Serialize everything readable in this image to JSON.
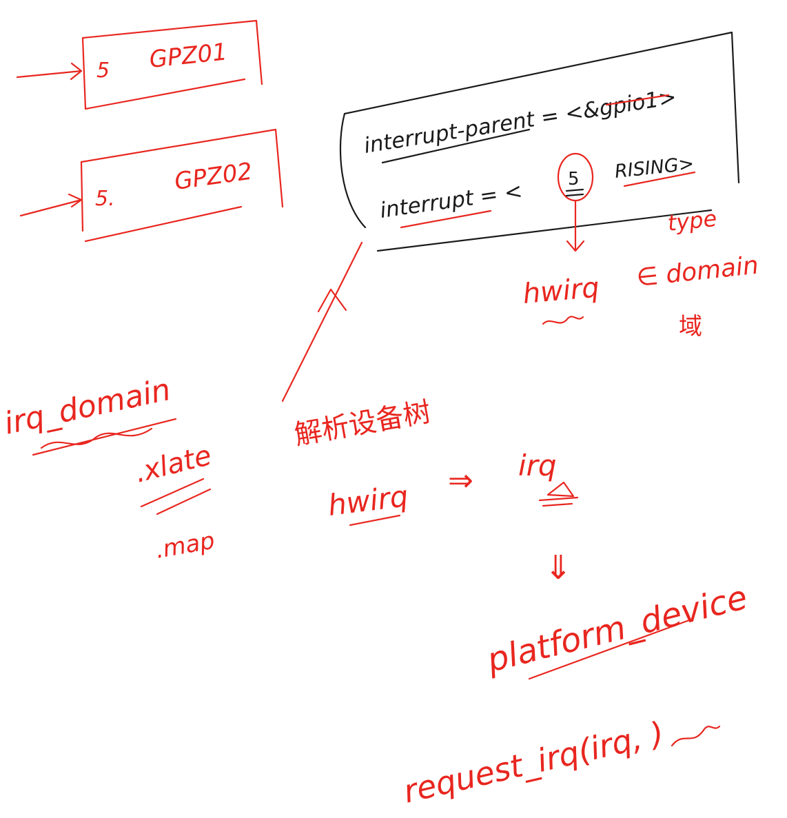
{
  "colors": {
    "ink_red": "#e8261f",
    "ink_black": "#1a1a1a",
    "paper": "#ffffff"
  },
  "gpio_boxes": [
    {
      "number": "5",
      "name": "GPZ01"
    },
    {
      "number": "5.",
      "name": "GPZ02"
    }
  ],
  "dts_node": {
    "parent_line": "interrupt-parent = <&gpio1>",
    "interrupt_line_prefix": "interrupt = <",
    "interrupt_number": "5",
    "interrupt_type": "RISING>",
    "type_label": "type"
  },
  "hwirq_annotation": {
    "hwirq": "hwirq",
    "domain": "∈ domain",
    "domain_cn": "域"
  },
  "irq_domain": {
    "title": "irq_domain",
    "xlate": ".xlate",
    "map": ".map"
  },
  "parse_flow": {
    "caption": "解析设备树",
    "hwirq": "hwirq",
    "arrow": "⇒",
    "irq": "irq",
    "down_arrow": "⇓",
    "platform_device": "platform_device",
    "request_irq": "request_irq(irq, )"
  }
}
